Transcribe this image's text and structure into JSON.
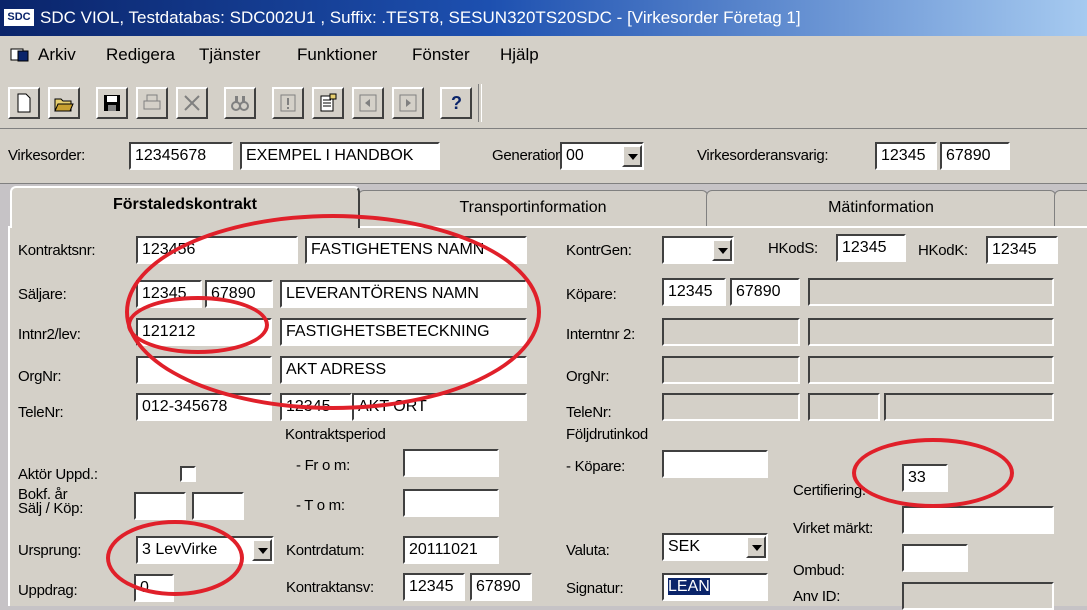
{
  "title": {
    "logo": "SDC",
    "text": "SDC VIOL, Testdatabas: SDC002U1 , Suffix: .TEST8, SESUN320TS20SDC - [Virkesorder Företag 1]"
  },
  "menu": [
    "Arkiv",
    "Redigera",
    "Tjänster",
    "Funktioner",
    "Fönster",
    "Hjälp"
  ],
  "toolbar": {
    "buttons": [
      "new-icon",
      "open-icon",
      "save-icon",
      "print-icon",
      "delete-icon",
      "find-icon",
      "exclamation-icon",
      "notes-icon",
      "prev-icon",
      "next-icon",
      "help-icon"
    ],
    "help_glyph": "?"
  },
  "header": {
    "virkesorder_label": "Virkesorder:",
    "virkesorder_nr": "12345678",
    "virkesorder_name": "EXEMPEL I HANDBOK",
    "generation_label": "Generation:",
    "generation_value": "00",
    "ansvarig_label": "Virkesorderansvarig:",
    "ansvarig_1": "12345",
    "ansvarig_2": "67890"
  },
  "tabs": [
    "Förstaledskontrakt",
    "Transportinformation",
    "Mätinformation"
  ],
  "form": {
    "kontraktsnr_label": "Kontraktsnr:",
    "kontraktsnr": "123456",
    "fastighetens_namn": "FASTIGHETENS NAMN",
    "saljare_label": "Säljare:",
    "saljare_1": "12345",
    "saljare_2": "67890",
    "leverantorens_namn": "LEVERANTÖRENS NAMN",
    "intnr_label": "Intnr2/lev:",
    "intnr": "121212",
    "fastighetsbeteckning": "FASTIGHETSBETECKNING",
    "orgnr_label": "OrgNr:",
    "orgnr": "",
    "akt_adress": "AKT ADRESS",
    "telenr_label": "TeleNr:",
    "telenr": "012-345678",
    "postnr": "12345",
    "akt_ort": "AKT ORT",
    "kontraktsperiod_label": "Kontraktsperiod",
    "from_label": "- Fr o m:",
    "tom_label": "- T o m:",
    "aktor_label": "Aktör Uppd.:",
    "bokf_label_1": "Bokf. år",
    "bokf_label_2": "Sälj / Köp:",
    "ursprung_label": "Ursprung:",
    "ursprung_value": "3 LevVirke",
    "uppdrag_label": "Uppdrag:",
    "uppdrag_value": "0",
    "kontrdatum_label": "Kontrdatum:",
    "kontrdatum": "20111021",
    "kontraktansv_label": "Kontraktansv:",
    "kontraktansv_1": "12345",
    "kontraktansv_2": "67890",
    "kontrgen_label": "KontrGen:",
    "kontrgen_value": "",
    "hkods_label": "HKodS:",
    "hkods": "12345",
    "hkodk_label": "HKodK:",
    "hkodk": "12345",
    "kopare_label": "Köpare:",
    "kopare_1": "12345",
    "kopare_2": "67890",
    "interntnr_label": "Interntnr 2:",
    "orgnr2_label": "OrgNr:",
    "telenr2_label": "TeleNr:",
    "foljdrutinkod_label": "Följdrutinkod",
    "fkopare_label": "- Köpare:",
    "valuta_label": "Valuta:",
    "valuta_value": "SEK",
    "signatur_label": "Signatur:",
    "signatur_value": "LEAN",
    "certifiering_label": "Certifiering:",
    "certifiering_value": "33",
    "virket_label": "Virket märkt:",
    "ombud_label": "Ombud:",
    "anvid_label": "Anv ID:"
  },
  "colors": {
    "annotation_red": "#e0202a",
    "titlebar_blue": "#0a246a",
    "window_gray": "#d4d0c8"
  }
}
